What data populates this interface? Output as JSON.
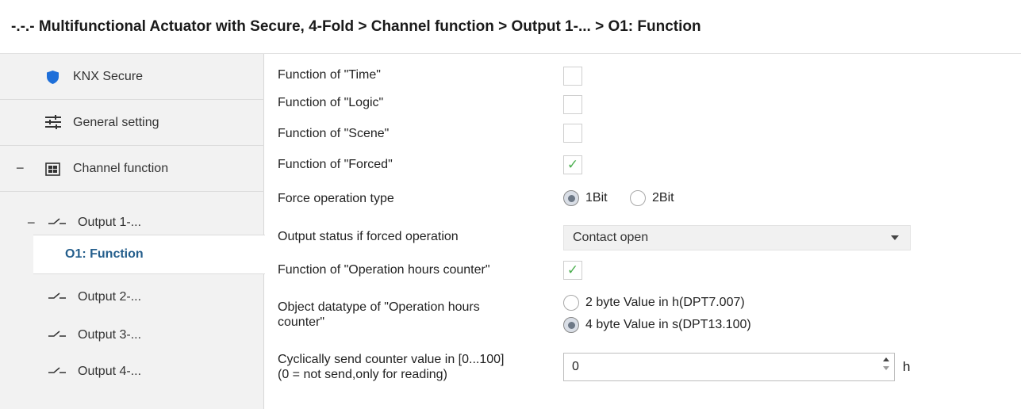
{
  "title": "-.-.- Multifunctional Actuator with Secure, 4-Fold > Channel function > Output 1-... > O1: Function",
  "sidebar": {
    "items": [
      {
        "label": "KNX Secure"
      },
      {
        "label": "General setting"
      },
      {
        "label": "Channel function",
        "expander": "−"
      },
      {
        "label": "Output 1-...",
        "expander": "−"
      },
      {
        "label": "O1: Function"
      },
      {
        "label": "Output 2-..."
      },
      {
        "label": "Output 3-..."
      },
      {
        "label": "Output 4-..."
      }
    ]
  },
  "params": {
    "time_label": "Function of \"Time\"",
    "logic_label": "Function of \"Logic\"",
    "scene_label": "Function of \"Scene\"",
    "forced_label": "Function of \"Forced\"",
    "forced_check": "✓",
    "force_type_label": "Force operation type",
    "force_type_options": [
      "1Bit",
      "2Bit"
    ],
    "force_type_selected": "1Bit",
    "output_status_label": "Output status if forced operation",
    "output_status_value": "Contact open",
    "hours_counter_label": "Function of \"Operation hours counter\"",
    "hours_counter_check": "✓",
    "datatype_label_line1": "Object datatype of \"Operation hours",
    "datatype_label_line2": "counter\"",
    "datatype_options": [
      "2 byte Value in h(DPT7.007)",
      "4 byte Value in s(DPT13.100)"
    ],
    "datatype_selected": "4 byte Value in s(DPT13.100)",
    "cyclic_label_line1": "Cyclically send counter value in [0...100]",
    "cyclic_label_line2": "(0 = not send,only for reading)",
    "cyclic_value": "0",
    "cyclic_unit": "h"
  }
}
